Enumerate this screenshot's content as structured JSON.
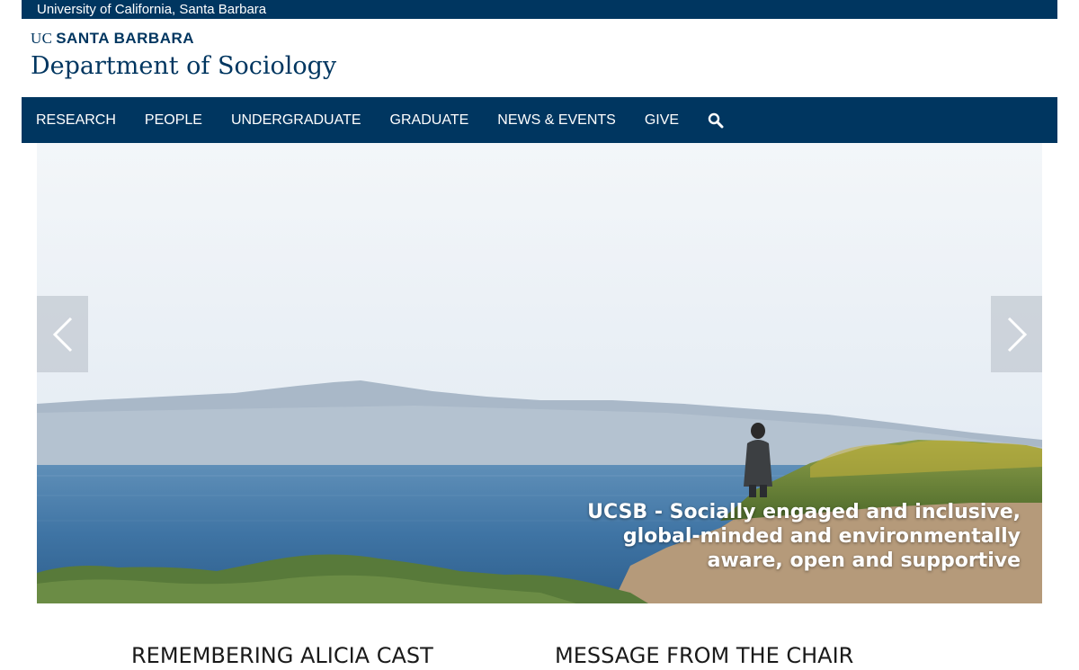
{
  "header": {
    "university": "University of California, Santa Barbara",
    "brand_uc": "UC",
    "brand_santa_barbara": "SANTA BARBARA",
    "department": "Department of Sociology"
  },
  "nav": {
    "items": [
      {
        "label": "RESEARCH"
      },
      {
        "label": "PEOPLE"
      },
      {
        "label": "UNDERGRADUATE"
      },
      {
        "label": "GRADUATE"
      },
      {
        "label": "NEWS & EVENTS"
      },
      {
        "label": "GIVE"
      }
    ],
    "search_icon": "search-icon"
  },
  "hero": {
    "caption_lines": [
      "UCSB - Socially engaged and inclusive,",
      "global-minded and environmentally",
      "aware, open and supportive"
    ],
    "prev_icon": "chevron-left-icon",
    "next_icon": "chevron-right-icon"
  },
  "sections": {
    "left_heading": "REMEMBERING ALICIA CAST",
    "right_heading": "MESSAGE FROM THE CHAIR"
  },
  "colors": {
    "brand_navy": "#003660",
    "background": "#ffffff",
    "heading_text": "#1a1a1a"
  }
}
